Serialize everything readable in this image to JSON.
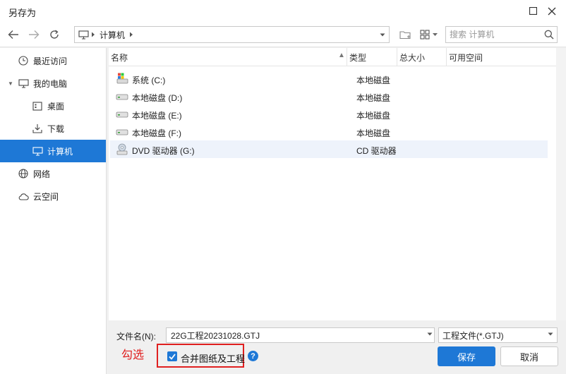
{
  "window": {
    "title": "另存为"
  },
  "address": {
    "path": "计算机"
  },
  "search": {
    "placeholder": "搜索 计算机"
  },
  "sidebar": {
    "items": [
      {
        "label": "最近访问",
        "icon": "clock-icon"
      },
      {
        "label": "我的电脑",
        "icon": "monitor-icon"
      },
      {
        "label": "桌面",
        "icon": "desktop-icon"
      },
      {
        "label": "下载",
        "icon": "download-icon"
      },
      {
        "label": "计算机",
        "icon": "computer-icon",
        "selected": true
      },
      {
        "label": "网络",
        "icon": "globe-icon"
      },
      {
        "label": "云空间",
        "icon": "cloud-icon"
      }
    ]
  },
  "table": {
    "columns": [
      "名称",
      "类型",
      "总大小",
      "可用空间"
    ],
    "rows": [
      {
        "name": "系统 (C:)",
        "type": "本地磁盘",
        "icon": "windows-drive-icon"
      },
      {
        "name": "本地磁盘 (D:)",
        "type": "本地磁盘",
        "icon": "drive-icon"
      },
      {
        "name": "本地磁盘 (E:)",
        "type": "本地磁盘",
        "icon": "drive-icon"
      },
      {
        "name": "本地磁盘 (F:)",
        "type": "本地磁盘",
        "icon": "drive-icon"
      },
      {
        "name": "DVD 驱动器 (G:)",
        "type": "CD 驱动器",
        "icon": "dvd-icon"
      }
    ]
  },
  "bottom": {
    "filename_label": "文件名(N):",
    "filename_value": "22G工程20231028.GTJ",
    "filetype": "工程文件(*.GTJ)",
    "annotation": "勾选",
    "checkbox_label": "合并图纸及工程",
    "help": "?",
    "save": "保存",
    "cancel": "取消"
  },
  "colors": {
    "accent": "#1e78d6",
    "annotation": "#e02020"
  }
}
